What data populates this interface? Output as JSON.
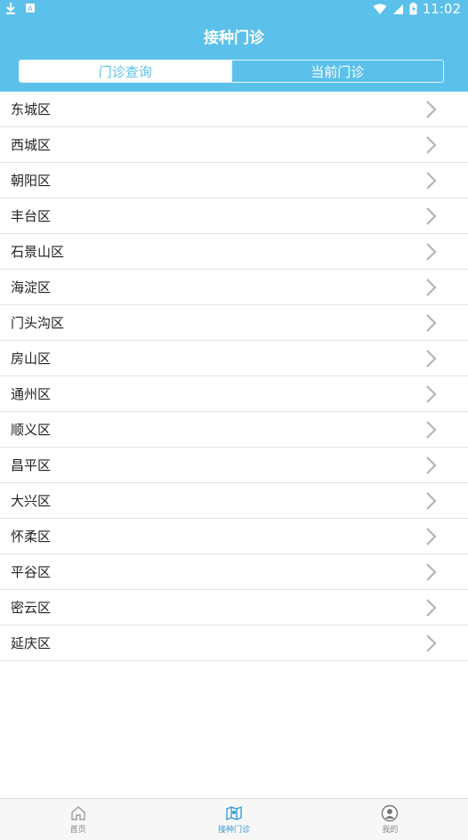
{
  "status_bar": {
    "time": "11:02"
  },
  "header": {
    "title": "接种门诊"
  },
  "segmented": {
    "tabs": [
      "门诊查询",
      "当前门诊"
    ],
    "active_index": 0
  },
  "districts": [
    "东城区",
    "西城区",
    "朝阳区",
    "丰台区",
    "石景山区",
    "海淀区",
    "门头沟区",
    "房山区",
    "通州区",
    "顺义区",
    "昌平区",
    "大兴区",
    "怀柔区",
    "平谷区",
    "密云区",
    "延庆区"
  ],
  "bottom_nav": {
    "items": [
      "首页",
      "接种门诊",
      "我的"
    ],
    "active_index": 1
  },
  "colors": {
    "primary": "#5bc1ea",
    "nav_active": "#3b9bd6"
  },
  "icons": [
    "download-icon",
    "android-icon",
    "wifi-icon",
    "signal-icon",
    "battery-icon",
    "chevron-right-icon",
    "home-icon",
    "map-icon",
    "user-icon"
  ]
}
